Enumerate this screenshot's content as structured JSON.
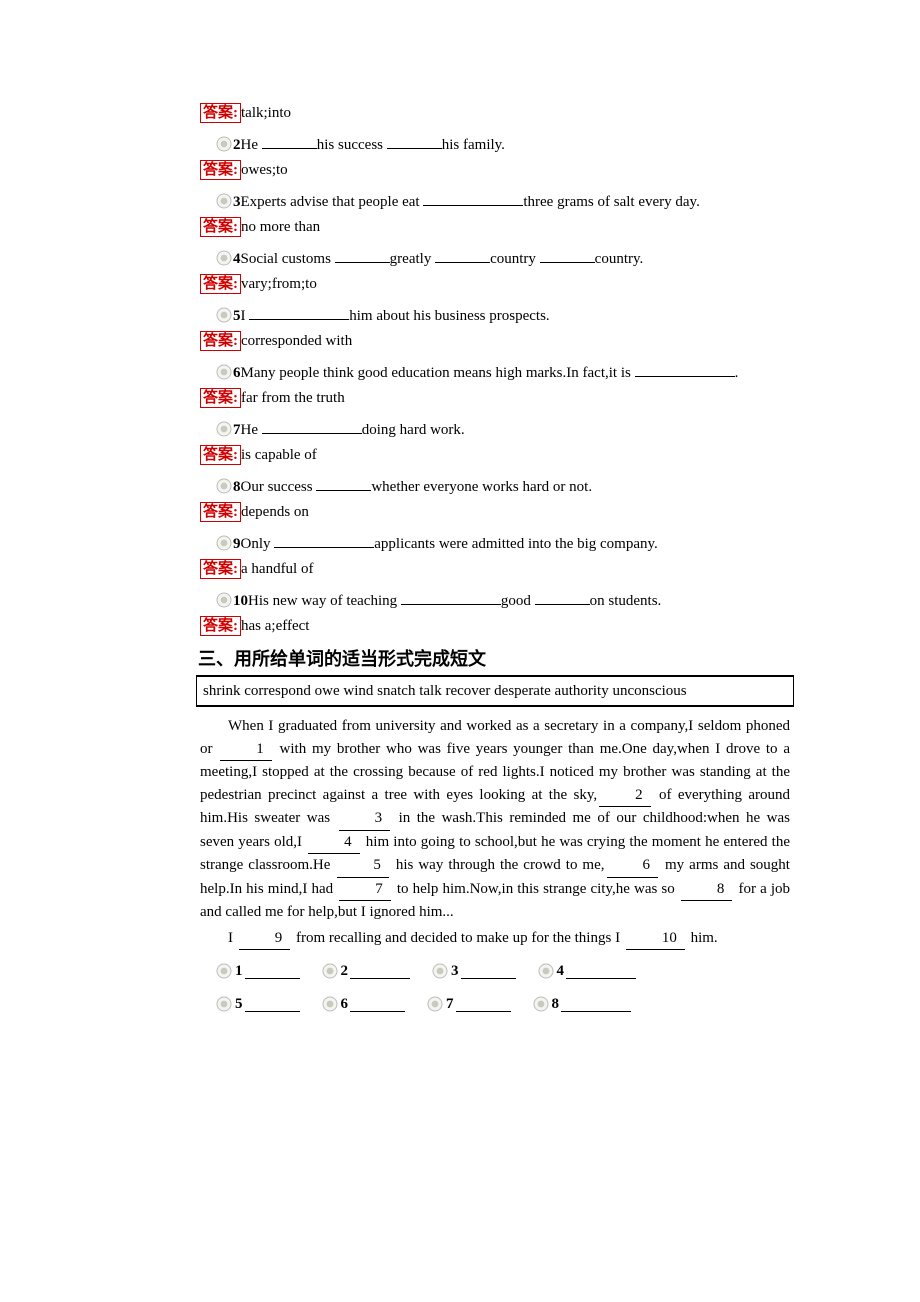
{
  "labels": {
    "answer": "答案:",
    "section3": "三、用所给单词的适当形式完成短文"
  },
  "q1": {
    "answer": "talk;into"
  },
  "q2": {
    "num": "2",
    "t1": "He ",
    "t2": "his success ",
    "t3": "his family.",
    "answer": "owes;to"
  },
  "q3": {
    "num": "3",
    "t1": "Experts advise that people eat ",
    "t2": "three grams of salt every day.",
    "answer": "no more than"
  },
  "q4": {
    "num": "4",
    "t1": "Social customs ",
    "t2": "greatly ",
    "t3": "country ",
    "t4": "country.",
    "answer": "vary;from;to"
  },
  "q5": {
    "num": "5",
    "t1": "I ",
    "t2": "him about his business prospects.",
    "answer": "corresponded with"
  },
  "q6": {
    "num": "6",
    "t1": "Many people think good education means high marks.In fact,it is ",
    "t2": ".",
    "answer": "far from the truth"
  },
  "q7": {
    "num": "7",
    "t1": "He ",
    "t2": "doing hard work.",
    "answer": "is capable of"
  },
  "q8": {
    "num": "8",
    "t1": "Our success ",
    "t2": "whether everyone works hard or not.",
    "answer": "depends on"
  },
  "q9": {
    "num": "9",
    "t1": "Only ",
    "t2": "applicants were admitted into the big company.",
    "answer": "a handful of"
  },
  "q10": {
    "num": "10",
    "t1": "His new way of teaching ",
    "t2": "good ",
    "t3": "on students.",
    "answer": "has a;effect"
  },
  "wordbank": "shrink    correspond    owe    wind    snatch    talk    recover    desperate    authority    unconscious",
  "passage": {
    "s1a": "When I graduated from university and worked as a secretary in a company,I seldom phoned or ",
    "b1": " 1 ",
    "s1b": " with my brother who was five years younger than me.One day,when I drove to a meeting,I stopped at the crossing because of red lights.I noticed my brother was standing at the pedestrian precinct against a tree with eyes looking at the sky,",
    "b2": " 2 ",
    "s1c": " of everything around him.His sweater was ",
    "b3": " 3 ",
    "s1d": " in the wash.This reminded me of our childhood:when he was seven years old,I ",
    "b4": " 4 ",
    "s1e": " him into going to school,but he was crying the moment he entered the strange classroom.He ",
    "b5": " 5 ",
    "s1f": " his way through the crowd to me,",
    "b6": " 6 ",
    "s1g": " my arms and sought help.In his mind,I had ",
    "b7": " 7 ",
    "s1h": " to help him.Now,in this strange city,he was so ",
    "b8": " 8 ",
    "s1i": " for a job and called me for help,but I ignored him...",
    "s2a": "I ",
    "b9": " 9 ",
    "s2b": " from recalling and decided to make up for the things I ",
    "b10": " 10 ",
    "s2c": " him."
  },
  "fill": {
    "n1": "1",
    "n2": "2",
    "n3": "3",
    "n4": "4",
    "n5": "5",
    "n6": "6",
    "n7": "7",
    "n8": "8"
  }
}
